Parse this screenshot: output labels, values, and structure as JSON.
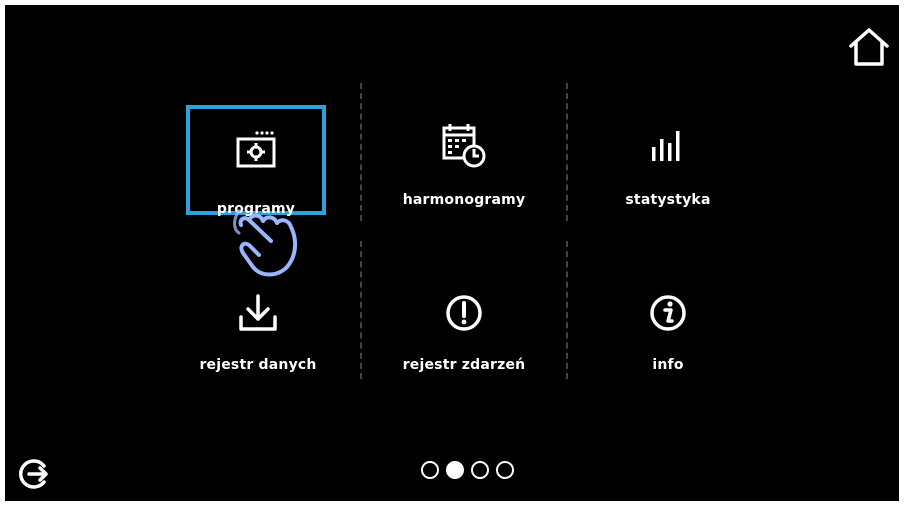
{
  "colors": {
    "background": "#000000",
    "text": "#ffffff",
    "selection": "#2aa3dc",
    "cursor": "#8fb0ff"
  },
  "menu": {
    "items": [
      {
        "label": "programy",
        "icon": "program-settings-icon",
        "selected": true
      },
      {
        "label": "harmonogramy",
        "icon": "calendar-schedule-icon",
        "selected": false
      },
      {
        "label": "statystyka",
        "icon": "bar-chart-icon",
        "selected": false
      },
      {
        "label": "rejestr danych",
        "icon": "download-icon",
        "selected": false
      },
      {
        "label": "rejestr zdarzeń",
        "icon": "alert-icon",
        "selected": false
      },
      {
        "label": "info",
        "icon": "info-icon",
        "selected": false
      }
    ]
  },
  "header": {
    "home_icon": "home-icon"
  },
  "footer": {
    "exit_icon": "exit-icon",
    "pages": 4,
    "current_page": 2
  },
  "overlay": {
    "pointer_icon": "hand-pointer-icon"
  }
}
